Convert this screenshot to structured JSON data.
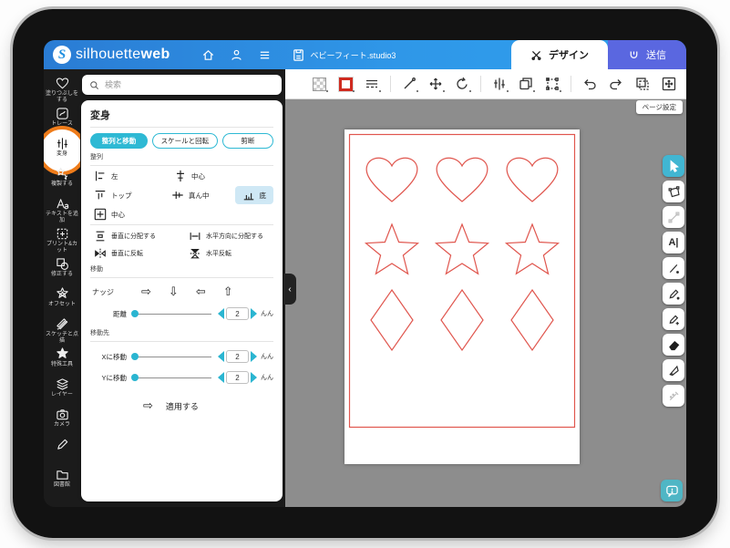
{
  "topbar": {
    "brand_light": "silhouette",
    "brand_bold": "web",
    "file_name": "ベビーフィート.studio3",
    "design_tab": "デザイン",
    "send_tab": "送信",
    "icons": [
      "home-icon",
      "user-icon",
      "menu-icon",
      "file-icon"
    ]
  },
  "sidebar": {
    "items": [
      {
        "label": "塗りつぶしをする",
        "icon": "heart-fill-icon"
      },
      {
        "label": "トレース",
        "icon": "trace-icon"
      },
      {
        "label": "変身",
        "icon": "transform-icon",
        "active": true,
        "annotation": "orange-circle"
      },
      {
        "label": "複製する",
        "icon": "replicate-icon"
      },
      {
        "label": "テキストを追加",
        "icon": "text-icon"
      },
      {
        "label": "プリント&カット",
        "icon": "print-cut-icon"
      },
      {
        "label": "修正する",
        "icon": "modify-icon"
      },
      {
        "label": "オフセット",
        "icon": "offset-icon"
      },
      {
        "label": "スケッチと点描",
        "icon": "sketch-icon"
      },
      {
        "label": "特殊工具",
        "icon": "special-tools-icon"
      },
      {
        "label": "レイヤー",
        "icon": "layers-icon"
      },
      {
        "label": "カメラ",
        "icon": "camera-icon"
      },
      {
        "label": "",
        "icon": "pen-icon"
      },
      {
        "label": "図書館",
        "icon": "library-icon"
      }
    ]
  },
  "panel": {
    "search_placeholder": "検索",
    "title": "変身",
    "tabs": [
      {
        "label": "整列と移動",
        "active": true
      },
      {
        "label": "スケールと回転",
        "active": false
      },
      {
        "label": "剪断",
        "active": false
      }
    ],
    "align_section": {
      "label": "整列",
      "left": "左",
      "center_v": "中心",
      "top": "トップ",
      "middle": "真ん中",
      "bottom": "底",
      "center": "中心"
    },
    "distribute": {
      "vertical": "垂直に分配する",
      "horizontal": "水平方向に分配する"
    },
    "flip": {
      "vertical": "垂直に反転",
      "horizontal": "水平反転"
    },
    "move_section": {
      "label": "移動",
      "nudge": "ナッジ",
      "arrows": [
        "⇨",
        "⇩",
        "⇦",
        "⇧"
      ],
      "distance": "距離",
      "distance_value": "2",
      "unit": "んん"
    },
    "move_to_section": {
      "label": "移動先",
      "x": "Xに移動",
      "x_value": "2",
      "y": "Yに移動",
      "y_value": "2",
      "unit": "んん",
      "apply": "適用する",
      "apply_arrow": "⇨"
    },
    "collapse_glyph": "‹"
  },
  "canvas": {
    "page_setup": "ページ設定",
    "shapes": {
      "rows": [
        {
          "shape": "heart",
          "count": 3
        },
        {
          "shape": "star",
          "count": 3
        },
        {
          "shape": "diamond",
          "count": 3
        }
      ],
      "stroke_color": "#e0564e",
      "page_border_color": "#e0564e"
    }
  },
  "top_toolbar": {
    "tools": [
      "fill-swatch",
      "stroke-swatch",
      "line-style",
      "line-tool",
      "move-tool",
      "rotate-tool",
      "transform-tool",
      "duplicate-tool",
      "bounding-box-tool",
      "undo",
      "redo",
      "copy-page-tool",
      "fit-view-tool"
    ]
  },
  "right_toolbar": {
    "tools": [
      "select-tool",
      "shape-transform-tool",
      "point-edit-tool",
      "text-tool",
      "line-tool",
      "pencil-tool",
      "pen-tool",
      "eraser-tool",
      "knife-tool",
      "stipple-tool"
    ],
    "text_tool_glyph": "A|"
  },
  "colors": {
    "accent_cyan": "#2eb9d4",
    "send_purple": "#5a67e0",
    "annotation_orange": "#ef7c1a",
    "shape_red": "#e0564e",
    "canvas_gray": "#8d8d8d",
    "highlight_bg": "#cfe8f5"
  }
}
